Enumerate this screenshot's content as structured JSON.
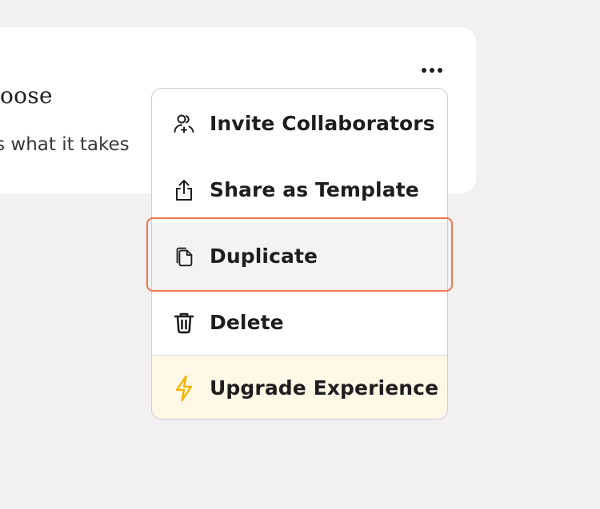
{
  "card": {
    "title": "oose",
    "description": "as what it takes"
  },
  "menu": {
    "items": [
      {
        "label": "Invite Collaborators",
        "icon": "users-plus-icon"
      },
      {
        "label": "Share as Template",
        "icon": "share-upload-icon"
      },
      {
        "label": "Duplicate",
        "icon": "duplicate-icon"
      },
      {
        "label": "Delete",
        "icon": "trash-icon"
      },
      {
        "label": "Upgrade Experience",
        "icon": "lightning-icon"
      }
    ]
  },
  "colors": {
    "background": "#f2f0f1",
    "highlight": "#f0784d",
    "upgrade_bg": "#fff8e7",
    "lightning": "#f5b400"
  }
}
